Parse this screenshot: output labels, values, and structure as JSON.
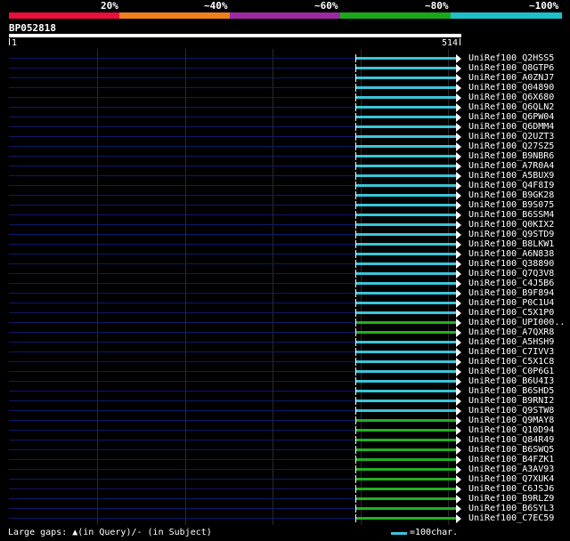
{
  "legend": {
    "labels": [
      "20%",
      "~40%",
      "~60%",
      "~80%",
      "~100%"
    ],
    "colors": [
      "#e8103c",
      "#f0801c",
      "#9c2aa0",
      "#1aa81a",
      "#20c0c8"
    ]
  },
  "query": {
    "name": "BP052818",
    "start": "1",
    "end": "514"
  },
  "hits": [
    {
      "label": "UniRef100_Q2HSS5",
      "color": "cyan"
    },
    {
      "label": "UniRef100_Q8GTP6",
      "color": "cyan"
    },
    {
      "label": "UniRef100_A0ZNJ7",
      "color": "cyan"
    },
    {
      "label": "UniRef100_Q04890",
      "color": "cyan"
    },
    {
      "label": "UniRef100_Q6X680",
      "color": "cyan"
    },
    {
      "label": "UniRef100_Q6QLN2",
      "color": "cyan"
    },
    {
      "label": "UniRef100_Q6PW04",
      "color": "cyan"
    },
    {
      "label": "UniRef100_Q6DMM4",
      "color": "cyan"
    },
    {
      "label": "UniRef100_Q2UZT3",
      "color": "cyan"
    },
    {
      "label": "UniRef100_Q27SZ5",
      "color": "cyan"
    },
    {
      "label": "UniRef100_B9NBR6",
      "color": "cyan"
    },
    {
      "label": "UniRef100_A7R0A4",
      "color": "cyan"
    },
    {
      "label": "UniRef100_A5BUX9",
      "color": "cyan"
    },
    {
      "label": "UniRef100_Q4F8I9",
      "color": "cyan"
    },
    {
      "label": "UniRef100_B9GK28",
      "color": "cyan"
    },
    {
      "label": "UniRef100_B9S075",
      "color": "cyan"
    },
    {
      "label": "UniRef100_B6SSM4",
      "color": "cyan"
    },
    {
      "label": "UniRef100_Q0KIX2",
      "color": "cyan"
    },
    {
      "label": "UniRef100_Q9STD9",
      "color": "cyan"
    },
    {
      "label": "UniRef100_B8LKW1",
      "color": "cyan"
    },
    {
      "label": "UniRef100_A6N838",
      "color": "cyan"
    },
    {
      "label": "UniRef100_Q38890",
      "color": "cyan"
    },
    {
      "label": "UniRef100_Q7Q3V8",
      "color": "cyan"
    },
    {
      "label": "UniRef100_C4J5B6",
      "color": "cyan"
    },
    {
      "label": "UniRef100_B9F894",
      "color": "cyan"
    },
    {
      "label": "UniRef100_P0C1U4",
      "color": "cyan"
    },
    {
      "label": "UniRef100_C5X1P0",
      "color": "cyan"
    },
    {
      "label": "UniRef100_UPI000..",
      "color": "green"
    },
    {
      "label": "UniRef100_A7QXR8",
      "color": "green"
    },
    {
      "label": "UniRef100_A5HSH9",
      "color": "cyan"
    },
    {
      "label": "UniRef100_C7IVV3",
      "color": "cyan"
    },
    {
      "label": "UniRef100_C5X1C8",
      "color": "cyan"
    },
    {
      "label": "UniRef100_C0P6G1",
      "color": "cyan"
    },
    {
      "label": "UniRef100_B6U4I3",
      "color": "cyan"
    },
    {
      "label": "UniRef100_B6SHD5",
      "color": "cyan"
    },
    {
      "label": "UniRef100_B9RNI2",
      "color": "cyan"
    },
    {
      "label": "UniRef100_Q9STW8",
      "color": "cyan"
    },
    {
      "label": "UniRef100_Q9MAY8",
      "color": "green"
    },
    {
      "label": "UniRef100_Q10D94",
      "color": "green"
    },
    {
      "label": "UniRef100_Q84R49",
      "color": "green"
    },
    {
      "label": "UniRef100_B6SWQ5",
      "color": "green"
    },
    {
      "label": "UniRef100_B4FZK1",
      "color": "green"
    },
    {
      "label": "UniRef100_A3AV93",
      "color": "green"
    },
    {
      "label": "UniRef100_Q7XUK4",
      "color": "green"
    },
    {
      "label": "UniRef100_C6JSJ6",
      "color": "green"
    },
    {
      "label": "UniRef100_B9RLZ9",
      "color": "green"
    },
    {
      "label": "UniRef100_B6SYL3",
      "color": "green"
    },
    {
      "label": "UniRef100_C7EC59",
      "color": "green"
    }
  ],
  "footer": {
    "gaps_text": "Large gaps: ▲(in Query)/- (in Subject)",
    "scale_text": "=100char."
  }
}
